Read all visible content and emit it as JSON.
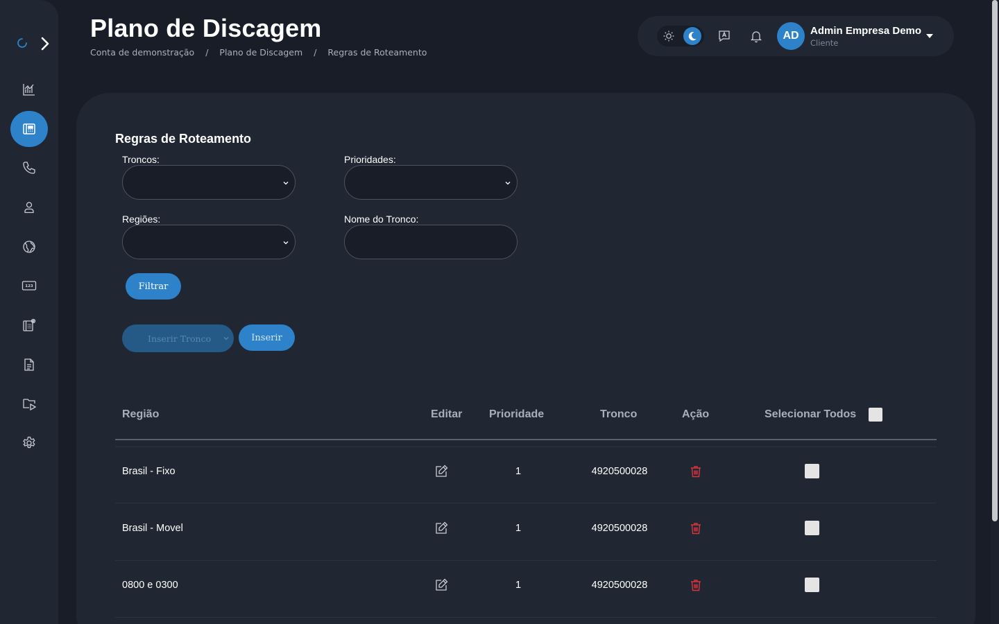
{
  "header": {
    "title": "Plano de Discagem",
    "breadcrumb": [
      "Conta de demonstração",
      "Plano de Discagem",
      "Regras de Roteamento"
    ],
    "separator": "/"
  },
  "user": {
    "initials": "AD",
    "name": "Admin Empresa Demo",
    "role": "Cliente"
  },
  "sidebar": {
    "items": [
      {
        "icon": "chart-icon",
        "active": false
      },
      {
        "icon": "dialplan-icon",
        "active": true
      },
      {
        "icon": "phone-icon",
        "active": false
      },
      {
        "icon": "user-icon",
        "active": false
      },
      {
        "icon": "globe-icon",
        "active": false
      },
      {
        "icon": "numbers-icon",
        "active": false
      },
      {
        "icon": "extension-settings-icon",
        "active": false
      },
      {
        "icon": "document-icon",
        "active": false
      },
      {
        "icon": "media-folder-icon",
        "active": false
      },
      {
        "icon": "settings-icon",
        "active": false
      }
    ]
  },
  "form": {
    "section_title": "Regras de Roteamento",
    "troncos_label": "Troncos:",
    "prioridades_label": "Prioridades:",
    "regioes_label": "Regiões:",
    "nome_tronco_label": "Nome do Tronco:",
    "filtrar_label": "Filtrar",
    "inserir_tronco_placeholder": "Inserir Tronco",
    "inserir_label": "Inserir"
  },
  "table": {
    "headers": {
      "regiao": "Região",
      "editar": "Editar",
      "prioridade": "Prioridade",
      "tronco": "Tronco",
      "acao": "Ação",
      "selecionar_todos": "Selecionar Todos"
    },
    "rows": [
      {
        "regiao": "Brasil - Fixo",
        "prioridade": "1",
        "tronco": "4920500028"
      },
      {
        "regiao": "Brasil - Movel",
        "prioridade": "1",
        "tronco": "4920500028"
      },
      {
        "regiao": "0800 e 0300",
        "prioridade": "1",
        "tronco": "4920500028"
      }
    ]
  },
  "colors": {
    "accent": "#2d82c9",
    "background": "#181d27",
    "card": "#202632",
    "danger": "#d9363e"
  }
}
